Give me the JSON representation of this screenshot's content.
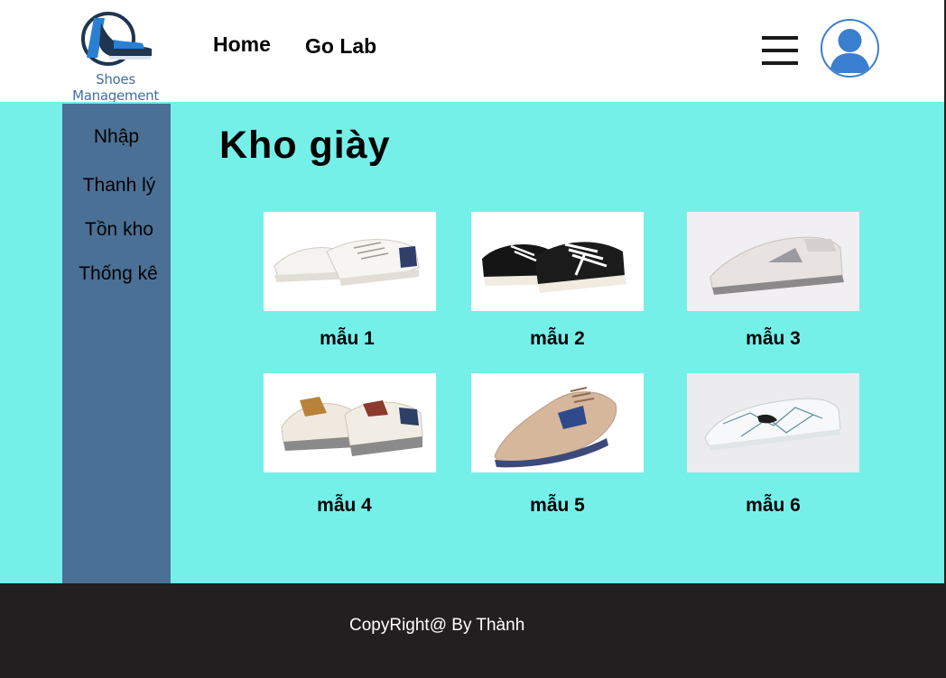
{
  "header": {
    "logo_text": "Shoes Management",
    "nav": [
      {
        "label": "Home"
      },
      {
        "label": "Go Lab"
      }
    ]
  },
  "sidebar": {
    "items": [
      {
        "label": "Nhập"
      },
      {
        "label": "Thanh lý"
      },
      {
        "label": "Tồn kho"
      },
      {
        "label": "Thống kê"
      }
    ]
  },
  "main": {
    "title": "Kho giày",
    "products": [
      {
        "label": "mẫu 1"
      },
      {
        "label": "mẫu 2"
      },
      {
        "label": "mẫu 3"
      },
      {
        "label": "mẫu 4"
      },
      {
        "label": "mẫu 5"
      },
      {
        "label": "mẫu 6"
      }
    ]
  },
  "footer": {
    "text": "CopyRight@ By Thành"
  },
  "colors": {
    "header_bg": "#ffffff",
    "main_bg": "#74f0e9",
    "sidebar_bg": "#4b7096",
    "footer_bg": "#221f20",
    "logo_blue": "#3f6fa7",
    "avatar_blue": "#3a7fcf"
  },
  "icons": [
    "shoe-logo-icon",
    "hamburger-menu-icon",
    "user-avatar-icon"
  ]
}
